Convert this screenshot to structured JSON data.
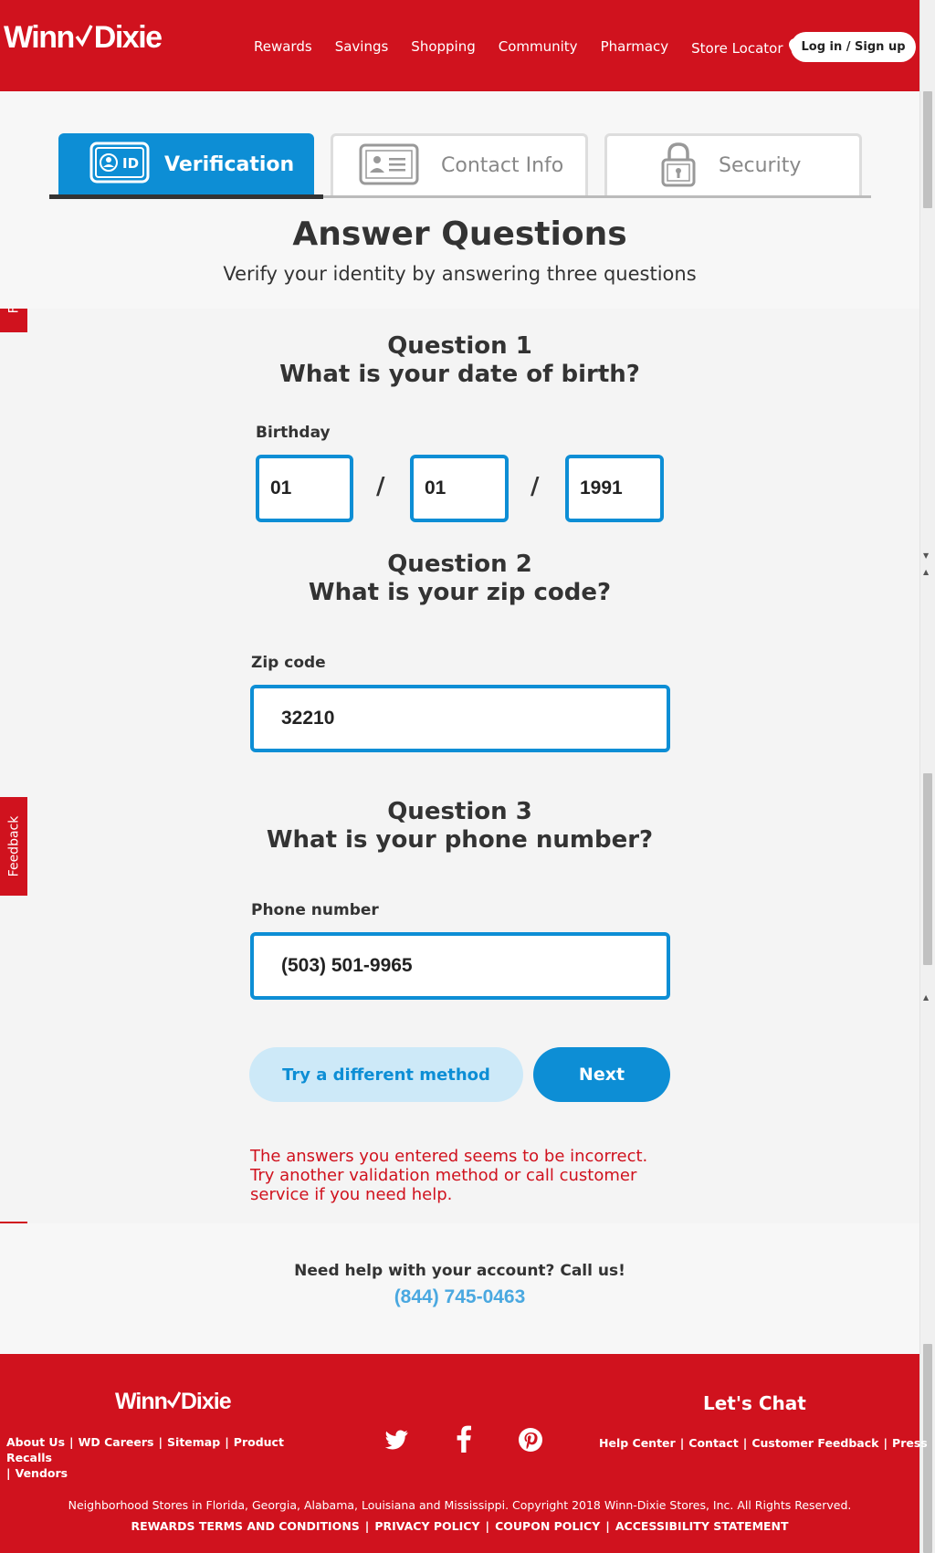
{
  "header": {
    "logo_left": "Winn",
    "logo_right": "Dixie",
    "nav": [
      "Rewards",
      "Savings",
      "Shopping",
      "Community",
      "Pharmacy",
      "Store Locator"
    ],
    "login_label": "Log in / Sign up"
  },
  "feedback_label": "Feedback",
  "tabs": [
    {
      "label": "Verification",
      "badge": "ID",
      "active": true
    },
    {
      "label": "Contact Info",
      "active": false
    },
    {
      "label": "Security",
      "active": false
    }
  ],
  "page": {
    "title": "Answer Questions",
    "subtitle": "Verify your identity by answering three questions"
  },
  "q1": {
    "number": "Question 1",
    "text": "What is your date of birth?",
    "label": "Birthday",
    "month": "01",
    "day": "01",
    "year": "1991",
    "separator": "/"
  },
  "q2": {
    "number": "Question 2",
    "text": "What is your zip code?",
    "label": "Zip code",
    "value": "32210"
  },
  "q3": {
    "number": "Question 3",
    "text": "What is your phone number?",
    "label": "Phone number",
    "value": "(503) 501-9965"
  },
  "buttons": {
    "alt": "Try a different method",
    "next": "Next"
  },
  "error": "The answers you entered seems to be incorrect. Try another validation method or call customer service if you need help.",
  "help": {
    "text": "Need help with your account? Call us!",
    "phone": "(844) 745-0463"
  },
  "footer": {
    "logo_left": "Winn",
    "logo_right": "Dixie",
    "links_left": [
      "About Us",
      "WD Careers",
      "Sitemap",
      "Product Recalls",
      "Vendors"
    ],
    "chat_title": "Let's Chat",
    "links_right": [
      "Help Center",
      "Contact",
      "Customer Feedback",
      "Press"
    ],
    "copyright": "Neighborhood Stores in Florida, Georgia, Alabama, Louisiana and Mississippi. Copyright 2018 Winn-Dixie Stores, Inc. All Rights Reserved.",
    "legal": [
      "REWARDS TERMS AND CONDITIONS",
      "PRIVACY POLICY",
      "COUPON POLICY",
      "ACCESSIBILITY STATEMENT"
    ]
  },
  "colors": {
    "brand_red": "#d0121e",
    "accent_blue": "#0d8ed5"
  }
}
